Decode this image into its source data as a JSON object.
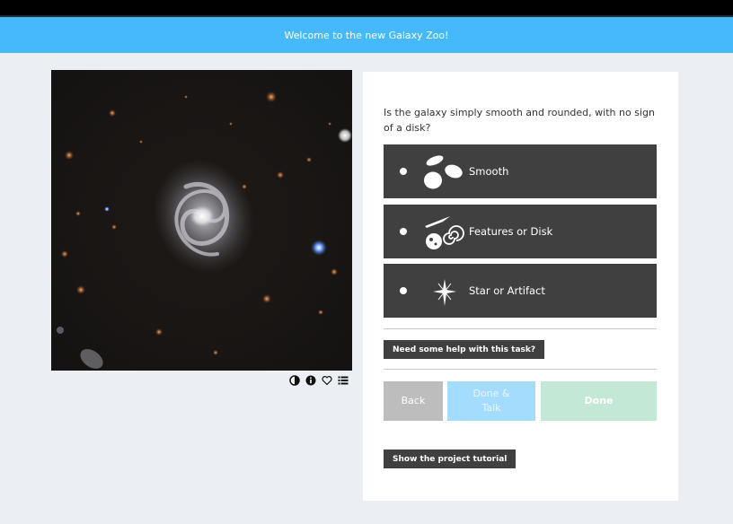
{
  "banner": {
    "text": "Welcome to the new Galaxy Zoo!"
  },
  "subject": {
    "image_icon": "galaxy-subject-image"
  },
  "image_tools": {
    "icons": [
      "invert-icon",
      "info-icon",
      "favorite-icon",
      "collections-icon"
    ]
  },
  "task": {
    "question": "Is the galaxy simply smooth and rounded, with no sign of a disk?",
    "answers": [
      {
        "label": "Smooth",
        "icon": "smooth-galaxy-icon"
      },
      {
        "label": "Features or Disk",
        "icon": "features-disk-icon"
      },
      {
        "label": "Star or Artifact",
        "icon": "star-artifact-icon"
      }
    ],
    "help_label": "Need some help with this task?",
    "back_label": "Back",
    "done_talk_label_line1": "Done &",
    "done_talk_label_line2": "Talk",
    "done_label": "Done",
    "tutorial_label": "Show the project tutorial"
  },
  "colors": {
    "banner": "#45b9fb",
    "answer_bg": "#404040",
    "back_btn": "#bdbdbd",
    "done_talk_btn": "#a4dcfd",
    "done_btn": "#c4e8d6",
    "page_bg": "#ebeff4"
  }
}
